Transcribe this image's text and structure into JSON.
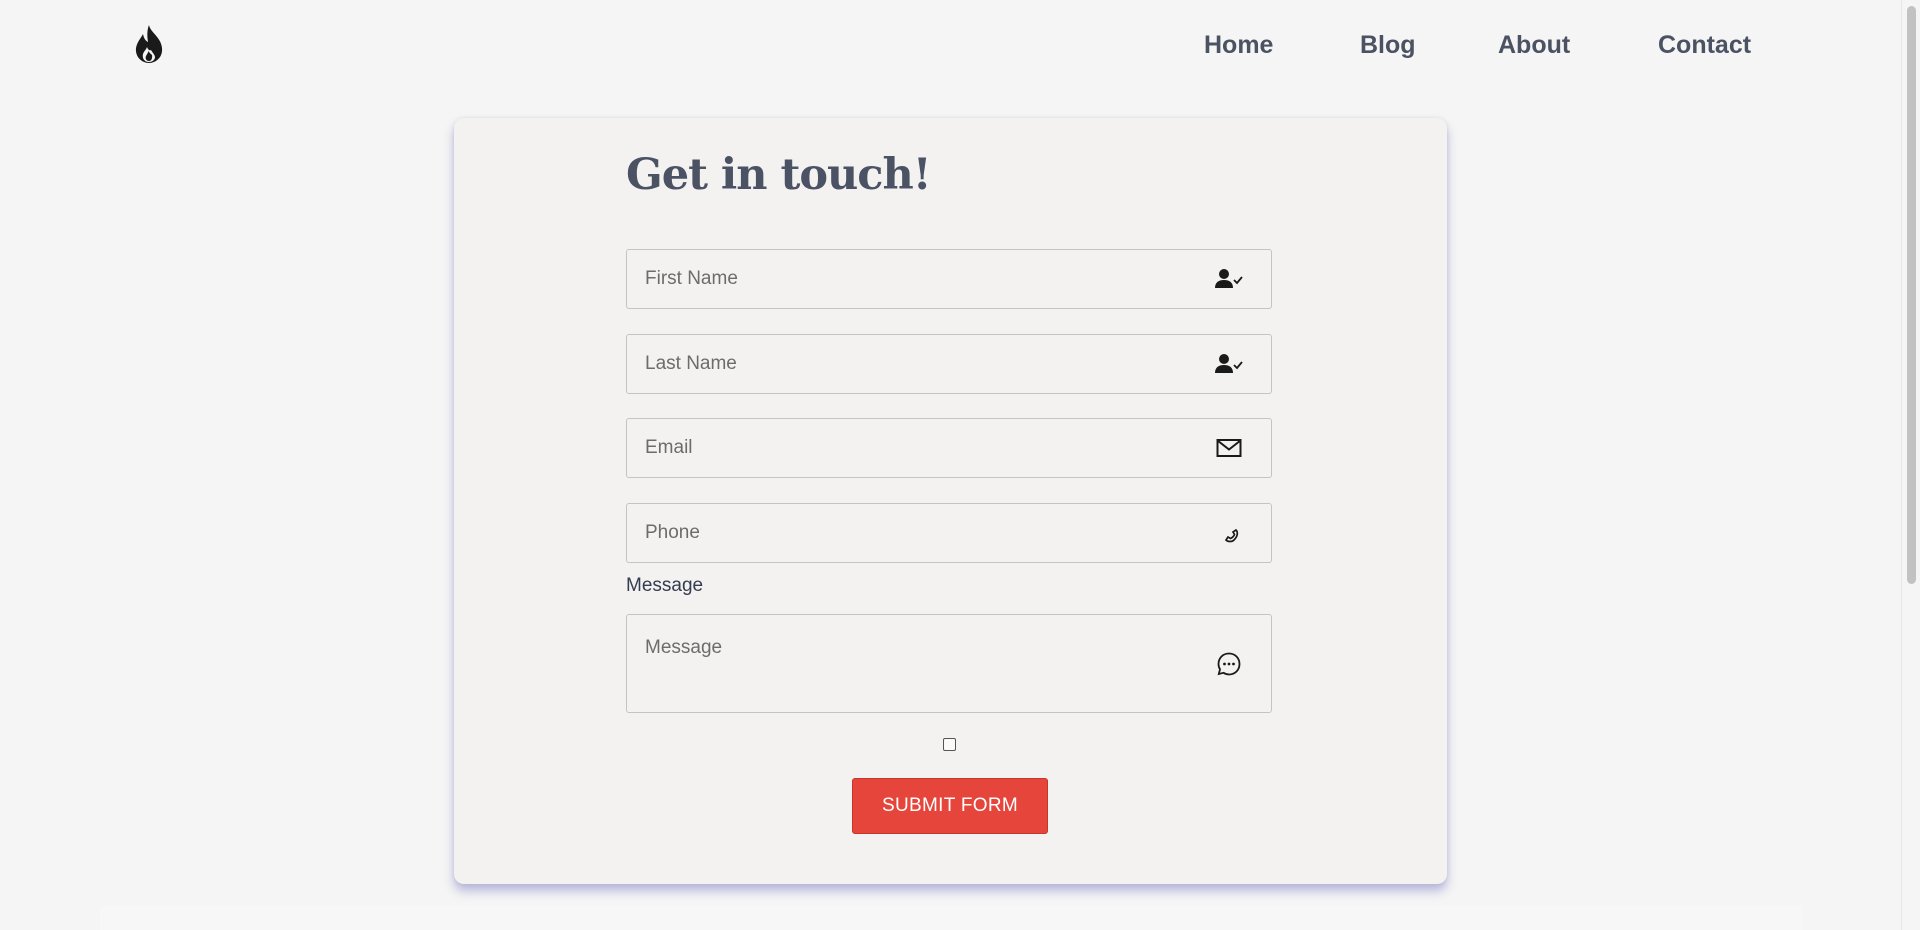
{
  "header": {
    "logo_icon": "flame-icon",
    "nav": [
      {
        "label": "Home"
      },
      {
        "label": "Blog"
      },
      {
        "label": "About"
      },
      {
        "label": "Contact"
      }
    ]
  },
  "form": {
    "title": "Get in touch!",
    "first_name": {
      "placeholder": "First Name",
      "icon": "user-check-icon"
    },
    "last_name": {
      "placeholder": "Last Name",
      "icon": "user-check-icon"
    },
    "email": {
      "placeholder": "Email",
      "icon": "envelope-icon"
    },
    "phone": {
      "placeholder": "Phone",
      "icon": "phone-icon"
    },
    "message_label": "Message",
    "message": {
      "placeholder": "Message",
      "icon": "chat-bubble-icon"
    },
    "checkbox_checked": false,
    "submit_label": "SUBMIT FORM"
  },
  "colors": {
    "background": "#f5f5f5",
    "card": "#f3f2f1",
    "text_dark": "#4a5263",
    "accent_red": "#e5453b",
    "card_shadow": "#9a9ad8"
  }
}
